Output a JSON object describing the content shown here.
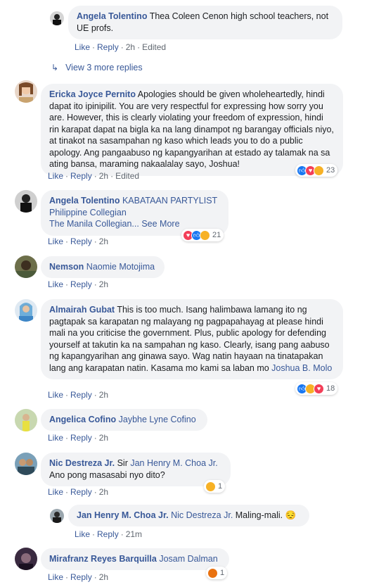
{
  "comments": [
    {
      "author": "Angela Tolentino",
      "text": " Thea Coleen Cenon high school teachers, not UE profs.",
      "like": "Like",
      "reply": "Reply",
      "time": "2h",
      "edited": "Edited"
    },
    {
      "author": "Ericka Joyce Pernito",
      "text": " Apologies should be given wholeheartedly, hindi dapat ito ipinipilit. You are very respectful for expressing how sorry you are. However, this is clearly violating your freedom of expression, hindi rin karapat dapat na bigla ka na lang dinampot ng barangay officials niyo, at tinakot na sasampahan ng kaso which leads you to do a public apology. Ang pangaabuso ng kapangyarihan at estado ay talamak na sa ating bansa, maraming nakaalalay sayo, Joshua!",
      "like": "Like",
      "reply": "Reply",
      "time": "2h",
      "edited": "Edited",
      "reaction_count": "23"
    },
    {
      "author": "Angela Tolentino",
      "mention": " KABATAAN PARTYLIST",
      "line2": "Philippine Collegian",
      "line3": "The Manila Collegian...",
      "see_more": " See More",
      "like": "Like",
      "reply": "Reply",
      "time": "2h",
      "reaction_count": "21"
    },
    {
      "author": "Nemson",
      "mention": " Naomie Motojima",
      "like": "Like",
      "reply": "Reply",
      "time": "2h"
    },
    {
      "author": "Almairah Gubat",
      "text": " This is too much. Isang halimbawa lamang ito ng pagtapak sa karapatan ng malayang ng pagpapahayag at please hindi mali na you criticise the government. Plus, public apology for defending yourself at takutin ka na sampahan ng kaso. Clearly, isang pang aabuso ng kapangyarihan ang ginawa sayo. Wag natin hayaan na tinatapakan lang ang karapatan natin. Kasama mo kami sa laban mo ",
      "mention": "Joshua B. Molo",
      "like": "Like",
      "reply": "Reply",
      "time": "2h",
      "reaction_count": "18"
    },
    {
      "author": "Angelica Cofino",
      "mention": " Jaybhe Lyne Cofino",
      "like": "Like",
      "reply": "Reply",
      "time": "2h"
    },
    {
      "author": "Nic Destreza Jr.",
      "text": " Sir ",
      "mention": "Jan Henry M. Choa Jr.",
      "line2": "Ano pong masasabi nyo dito?",
      "like": "Like",
      "reply": "Reply",
      "time": "2h",
      "reaction_count": "1"
    },
    {
      "author": "Jan Henry M. Choa Jr.",
      "mention": " Nic Destreza Jr.",
      "text": " Maling-mali. ",
      "emoji": "😔",
      "like": "Like",
      "reply": "Reply",
      "time": "21m"
    },
    {
      "author": "Mirafranz Reyes Barquilla",
      "mention": " Josam Dalman",
      "like": "Like",
      "reply": "Reply",
      "time": "2h",
      "reaction_count": "1"
    }
  ],
  "view_more": {
    "arrow": "↳",
    "label": "View 3 more replies"
  },
  "dot": "·",
  "icons": {
    "like": "like-icon",
    "love": "love-icon",
    "sad": "sad-icon",
    "angry": "angry-icon"
  },
  "colors": {
    "link": "#385898",
    "bubble": "#f2f3f5",
    "meta": "#606770",
    "like": "#1877f2",
    "love": "#f33e58",
    "sad": "#f7b125",
    "angry": "#e9710f"
  }
}
